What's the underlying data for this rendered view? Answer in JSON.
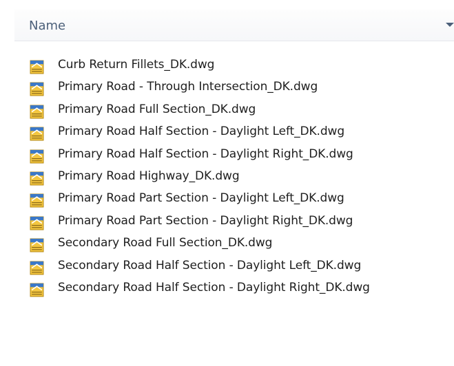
{
  "header": {
    "name_column_label": "Name"
  },
  "files": [
    {
      "name": "Curb Return Fillets_DK.dwg",
      "icon": "dwg-file-icon"
    },
    {
      "name": "Primary Road - Through Intersection_DK.dwg",
      "icon": "dwg-file-icon"
    },
    {
      "name": "Primary Road Full Section_DK.dwg",
      "icon": "dwg-file-icon"
    },
    {
      "name": "Primary Road Half Section - Daylight Left_DK.dwg",
      "icon": "dwg-file-icon"
    },
    {
      "name": "Primary Road Half Section - Daylight Right_DK.dwg",
      "icon": "dwg-file-icon"
    },
    {
      "name": "Primary Road Highway_DK.dwg",
      "icon": "dwg-file-icon"
    },
    {
      "name": "Primary Road Part Section - Daylight Left_DK.dwg",
      "icon": "dwg-file-icon"
    },
    {
      "name": "Primary Road Part Section - Daylight Right_DK.dwg",
      "icon": "dwg-file-icon"
    },
    {
      "name": "Secondary Road Full Section_DK.dwg",
      "icon": "dwg-file-icon"
    },
    {
      "name": "Secondary Road Half Section - Daylight Left_DK.dwg",
      "icon": "dwg-file-icon"
    },
    {
      "name": "Secondary Road Half Section - Daylight Right_DK.dwg",
      "icon": "dwg-file-icon"
    }
  ],
  "colors": {
    "header_text": "#4c607a",
    "file_text": "#1e1e1e",
    "icon_yellow": "#f3c640",
    "icon_blue": "#3a78c9"
  }
}
